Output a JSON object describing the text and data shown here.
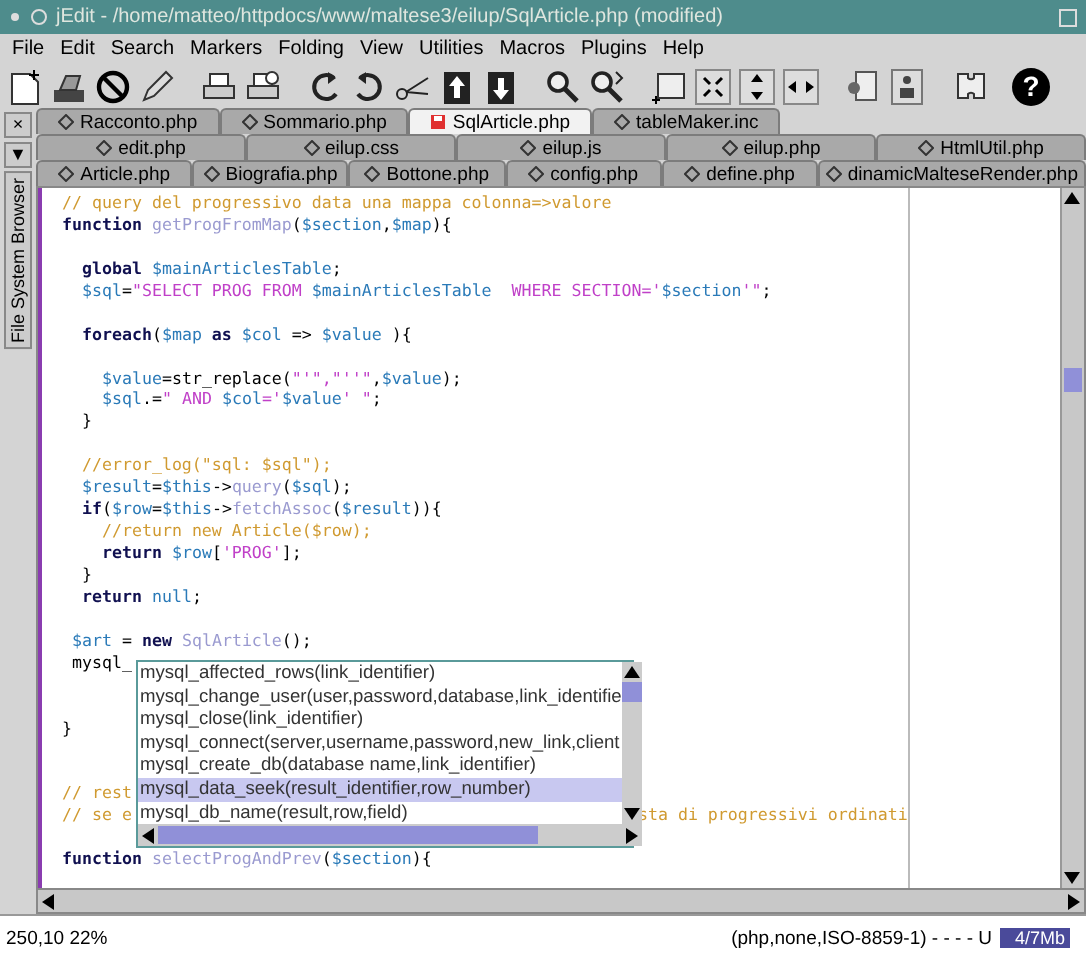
{
  "window": {
    "title": "jEdit - /home/matteo/httpdocs/www/maltese3/eilup/SqlArticle.php (modified)"
  },
  "menu": [
    {
      "label": "File"
    },
    {
      "label": "Edit"
    },
    {
      "label": "Search"
    },
    {
      "label": "Markers"
    },
    {
      "label": "Folding"
    },
    {
      "label": "View"
    },
    {
      "label": "Utilities"
    },
    {
      "label": "Macros"
    },
    {
      "label": "Plugins"
    },
    {
      "label": "Help"
    }
  ],
  "toolbar": {
    "help_glyph": "?"
  },
  "side_panel": {
    "close": "×",
    "menu": "▼",
    "label": "File System Browser"
  },
  "tab_rows": [
    [
      {
        "label": "Racconto.php",
        "selected": false,
        "modified": false
      },
      {
        "label": "Sommario.php",
        "selected": false,
        "modified": false
      },
      {
        "label": "SqlArticle.php",
        "selected": true,
        "modified": true
      },
      {
        "label": "tableMaker.inc",
        "selected": false,
        "modified": false
      }
    ],
    [
      {
        "label": "edit.php",
        "selected": false,
        "modified": false
      },
      {
        "label": "eilup.css",
        "selected": false,
        "modified": false
      },
      {
        "label": "eilup.js",
        "selected": false,
        "modified": false
      },
      {
        "label": "eilup.php",
        "selected": false,
        "modified": false
      },
      {
        "label": "HtmlUtil.php",
        "selected": false,
        "modified": false
      }
    ],
    [
      {
        "label": "Article.php",
        "selected": false,
        "modified": false
      },
      {
        "label": "Biografia.php",
        "selected": false,
        "modified": false
      },
      {
        "label": "Bottone.php",
        "selected": false,
        "modified": false
      },
      {
        "label": "config.php",
        "selected": false,
        "modified": false
      },
      {
        "label": "define.php",
        "selected": false,
        "modified": false
      },
      {
        "label": "dinamicMalteseRender.php",
        "selected": false,
        "modified": false
      }
    ]
  ],
  "code": [
    {
      "kind": "code",
      "segments": [
        {
          "kind": "comment",
          "text": "  // query del progressivo data una mappa colonna=>valore"
        }
      ]
    },
    {
      "kind": "code",
      "segments": [
        {
          "kind": "keyword",
          "text": "  function "
        },
        {
          "kind": "function",
          "text": "getProgFromMap"
        },
        {
          "kind": "plain",
          "text": "("
        },
        {
          "kind": "variable",
          "text": "$section"
        },
        {
          "kind": "plain",
          "text": ","
        },
        {
          "kind": "variable",
          "text": "$map"
        },
        {
          "kind": "plain",
          "text": "){"
        }
      ]
    },
    {
      "kind": "blank"
    },
    {
      "kind": "code",
      "segments": [
        {
          "kind": "keyword",
          "text": "    global "
        },
        {
          "kind": "variable",
          "text": "$mainArticlesTable"
        },
        {
          "kind": "plain",
          "text": ";"
        }
      ]
    },
    {
      "kind": "code",
      "segments": [
        {
          "kind": "variable",
          "text": "    $sql"
        },
        {
          "kind": "plain",
          "text": "="
        },
        {
          "kind": "string",
          "text": "\"SELECT PROG FROM "
        },
        {
          "kind": "variable",
          "text": "$mainArticlesTable"
        },
        {
          "kind": "string",
          "text": "  WHERE SECTION='"
        },
        {
          "kind": "variable",
          "text": "$section"
        },
        {
          "kind": "string",
          "text": "'\""
        },
        {
          "kind": "plain",
          "text": ";"
        }
      ]
    },
    {
      "kind": "blank"
    },
    {
      "kind": "code",
      "segments": [
        {
          "kind": "keyword",
          "text": "    foreach"
        },
        {
          "kind": "plain",
          "text": "("
        },
        {
          "kind": "variable",
          "text": "$map"
        },
        {
          "kind": "keyword",
          "text": " as "
        },
        {
          "kind": "variable",
          "text": "$col"
        },
        {
          "kind": "plain",
          "text": " => "
        },
        {
          "kind": "variable",
          "text": "$value"
        },
        {
          "kind": "plain",
          "text": " ){"
        }
      ]
    },
    {
      "kind": "blank"
    },
    {
      "kind": "code",
      "segments": [
        {
          "kind": "variable",
          "text": "      $value"
        },
        {
          "kind": "plain",
          "text": "=str_replace("
        },
        {
          "kind": "string",
          "text": "\"'\",\"''\""
        },
        {
          "kind": "plain",
          "text": ","
        },
        {
          "kind": "variable",
          "text": "$value"
        },
        {
          "kind": "plain",
          "text": ");"
        }
      ]
    },
    {
      "kind": "code",
      "segments": [
        {
          "kind": "variable",
          "text": "      $sql"
        },
        {
          "kind": "plain",
          "text": ".="
        },
        {
          "kind": "string",
          "text": "\" AND "
        },
        {
          "kind": "variable",
          "text": "$col"
        },
        {
          "kind": "string",
          "text": "='"
        },
        {
          "kind": "variable",
          "text": "$value"
        },
        {
          "kind": "string",
          "text": "' \""
        },
        {
          "kind": "plain",
          "text": ";"
        }
      ]
    },
    {
      "kind": "code",
      "segments": [
        {
          "kind": "plain",
          "text": "    }"
        }
      ]
    },
    {
      "kind": "blank"
    },
    {
      "kind": "code",
      "segments": [
        {
          "kind": "comment",
          "text": "    //error_log(\"sql: $sql\");"
        }
      ]
    },
    {
      "kind": "code",
      "segments": [
        {
          "kind": "variable",
          "text": "    $result"
        },
        {
          "kind": "plain",
          "text": "="
        },
        {
          "kind": "variable",
          "text": "$this"
        },
        {
          "kind": "plain",
          "text": "->"
        },
        {
          "kind": "function",
          "text": "query"
        },
        {
          "kind": "plain",
          "text": "("
        },
        {
          "kind": "variable",
          "text": "$sql"
        },
        {
          "kind": "plain",
          "text": ");"
        }
      ]
    },
    {
      "kind": "code",
      "segments": [
        {
          "kind": "keyword",
          "text": "    if"
        },
        {
          "kind": "plain",
          "text": "("
        },
        {
          "kind": "variable",
          "text": "$row"
        },
        {
          "kind": "plain",
          "text": "="
        },
        {
          "kind": "variable",
          "text": "$this"
        },
        {
          "kind": "plain",
          "text": "->"
        },
        {
          "kind": "function",
          "text": "fetchAssoc"
        },
        {
          "kind": "plain",
          "text": "("
        },
        {
          "kind": "variable",
          "text": "$result"
        },
        {
          "kind": "plain",
          "text": ")){"
        }
      ]
    },
    {
      "kind": "code",
      "segments": [
        {
          "kind": "comment",
          "text": "      //return new Article($row);"
        }
      ]
    },
    {
      "kind": "code",
      "segments": [
        {
          "kind": "keyword",
          "text": "      return "
        },
        {
          "kind": "variable",
          "text": "$row"
        },
        {
          "kind": "plain",
          "text": "["
        },
        {
          "kind": "string",
          "text": "'PROG'"
        },
        {
          "kind": "plain",
          "text": "];"
        }
      ]
    },
    {
      "kind": "code",
      "segments": [
        {
          "kind": "plain",
          "text": "    }"
        }
      ]
    },
    {
      "kind": "code",
      "segments": [
        {
          "kind": "keyword",
          "text": "    return "
        },
        {
          "kind": "variable",
          "text": "null"
        },
        {
          "kind": "plain",
          "text": ";"
        }
      ]
    },
    {
      "kind": "blank"
    },
    {
      "kind": "code",
      "segments": [
        {
          "kind": "variable",
          "text": "   $art"
        },
        {
          "kind": "plain",
          "text": " = "
        },
        {
          "kind": "keyword",
          "text": "new "
        },
        {
          "kind": "function",
          "text": "SqlArticle"
        },
        {
          "kind": "plain",
          "text": "();"
        }
      ]
    },
    {
      "kind": "code",
      "segments": [
        {
          "kind": "plain",
          "text": "   mysql_"
        }
      ]
    },
    {
      "kind": "blank"
    },
    {
      "kind": "blank"
    },
    {
      "kind": "code",
      "segments": [
        {
          "kind": "plain",
          "text": "  }"
        }
      ]
    },
    {
      "kind": "blank"
    },
    {
      "kind": "blank"
    },
    {
      "kind": "code",
      "segments": [
        {
          "kind": "comment",
          "text": "  // rest"
        }
      ]
    },
    {
      "kind": "code",
      "segments": [
        {
          "kind": "comment",
          "text": "  // se e"
        }
      ],
      "after_popup": [
        {
          "kind": "comment",
          "text": "sta di progressivi ordinati"
        }
      ]
    },
    {
      "kind": "blank"
    },
    {
      "kind": "code",
      "segments": [
        {
          "kind": "keyword",
          "text": "  function "
        },
        {
          "kind": "function",
          "text": "selectProgAndPrev"
        },
        {
          "kind": "plain",
          "text": "("
        },
        {
          "kind": "variable",
          "text": "$section"
        },
        {
          "kind": "plain",
          "text": "){"
        }
      ]
    }
  ],
  "completion": {
    "items": [
      {
        "text": "mysql_affected_rows(link_identifier)",
        "selected": false
      },
      {
        "text": "mysql_change_user(user,password,database,link_identifie",
        "selected": false
      },
      {
        "text": "mysql_close(link_identifier)",
        "selected": false
      },
      {
        "text": "mysql_connect(server,username,password,new_link,client",
        "selected": false
      },
      {
        "text": "mysql_create_db(database name,link_identifier)",
        "selected": false
      },
      {
        "text": "mysql_data_seek(result_identifier,row_number)",
        "selected": true
      },
      {
        "text": "mysql_db_name(result,row,field)",
        "selected": false
      }
    ]
  },
  "status_bar": {
    "position": "250,10 22%",
    "mode": "(php,none,ISO-8859-1) - - - - U",
    "memory": {
      "text": "4/7Mb",
      "level": 0.6
    }
  }
}
